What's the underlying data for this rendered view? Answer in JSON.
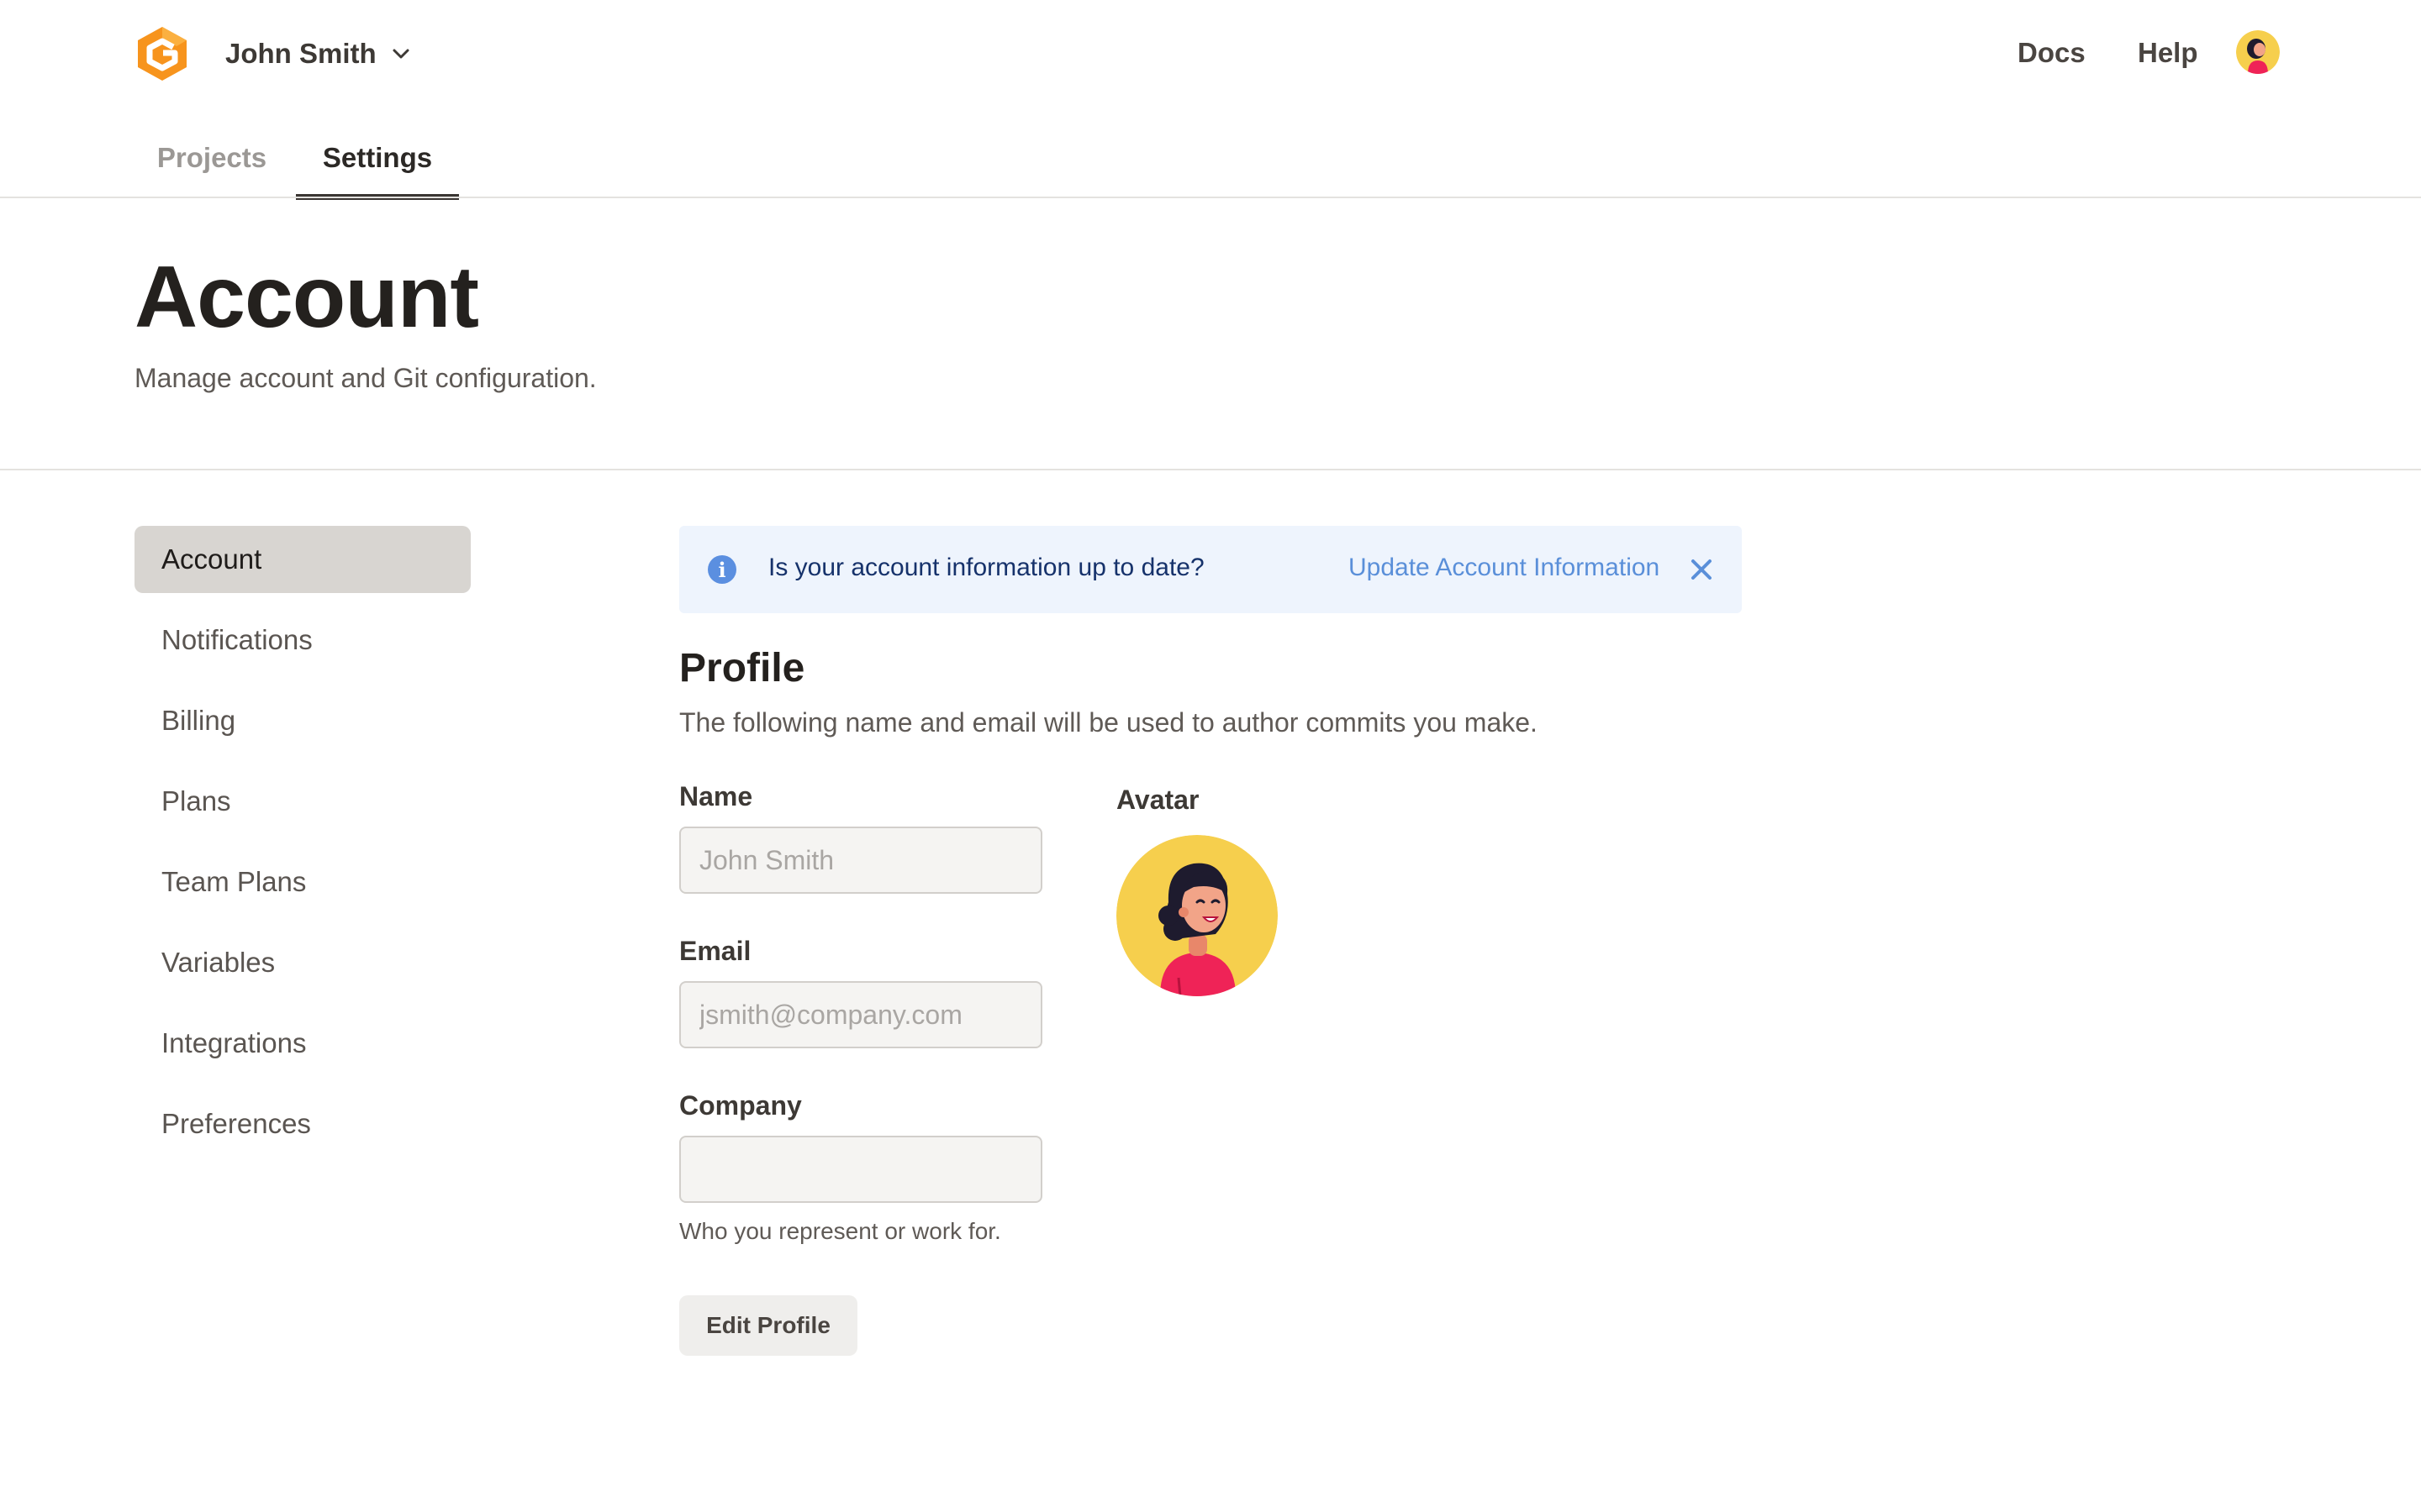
{
  "header": {
    "user_name": "John Smith",
    "links": {
      "docs": "Docs",
      "help": "Help"
    },
    "tabs": [
      {
        "label": "Projects",
        "active": false
      },
      {
        "label": "Settings",
        "active": true
      }
    ]
  },
  "page": {
    "title": "Account",
    "subtitle": "Manage account and Git configuration."
  },
  "sidebar": {
    "items": [
      {
        "label": "Account",
        "active": true
      },
      {
        "label": "Notifications"
      },
      {
        "label": "Billing"
      },
      {
        "label": "Plans"
      },
      {
        "label": "Team Plans"
      },
      {
        "label": "Variables"
      },
      {
        "label": "Integrations"
      },
      {
        "label": "Preferences"
      }
    ]
  },
  "banner": {
    "icon": "info-icon",
    "message": "Is your account information up to date?",
    "link_label": "Update Account Information",
    "close_icon": "close-icon"
  },
  "profile": {
    "title": "Profile",
    "subtitle": "The following name and email will be used to author commits you make.",
    "name_label": "Name",
    "name_placeholder": "John Smith",
    "email_label": "Email",
    "email_placeholder": "jsmith@company.com",
    "company_label": "Company",
    "company_value": "",
    "company_hint": "Who you represent or work for.",
    "avatar_label": "Avatar",
    "edit_button": "Edit Profile"
  },
  "colors": {
    "brand_orange": "#f7941d",
    "banner_bg": "#eef4fd",
    "info_blue": "#5b8fe0",
    "avatar_bg": "#f6cf4d",
    "avatar_shirt": "#ef2357"
  }
}
